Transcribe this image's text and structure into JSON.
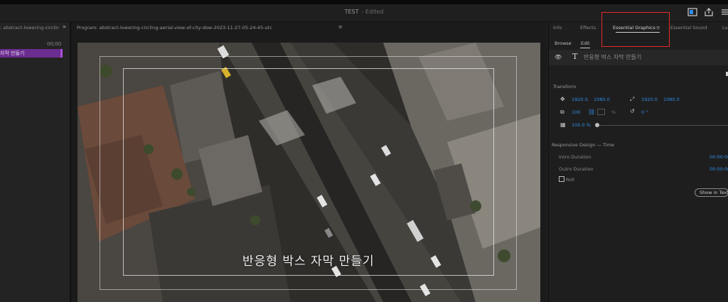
{
  "app": {
    "title": "TEST",
    "status": "- Edited"
  },
  "left_panel": {
    "tab_label": ": abstract-lowering-circlin",
    "more": "»",
    "timecode": "00;00",
    "clip_label": "자막 만들기"
  },
  "program": {
    "title": "Program: abstract-lowering-circling-aerial-view-of-city-dow-2023-11-27-05-24-45-utc",
    "menu": "≡",
    "caption": "반응형 박스 자막 만들기"
  },
  "right_panel": {
    "tabs": [
      "Info",
      "Effects",
      "Essential Graphics",
      "Essential Sound",
      "Lu"
    ],
    "eg_menu": "≡",
    "subtabs": [
      "Browse",
      "Edit"
    ],
    "layer": {
      "name": "반응형 박스 자막 만들기"
    },
    "transform": {
      "label": "Transform",
      "position_x": "1920.0",
      "position_y": "1080.0",
      "anchor_x": "1920.0",
      "anchor_y": "1080.0",
      "scale": "100",
      "scale_unit": "%",
      "rotation": "0 °",
      "opacity": "100.0 %"
    },
    "responsive": {
      "label": "Responsive Design — Time",
      "intro_label": "Intro Duration",
      "intro_value": "00:00:00",
      "outro_label": "Outro Duration",
      "outro_value": "00:00:00",
      "roll_label": "Roll",
      "show_button": "Show in Text panel"
    }
  },
  "colors": {
    "accent_blue": "#2e8ce6",
    "clip_purple": "#6b2d8f",
    "highlight_red": "#e32b2b"
  }
}
